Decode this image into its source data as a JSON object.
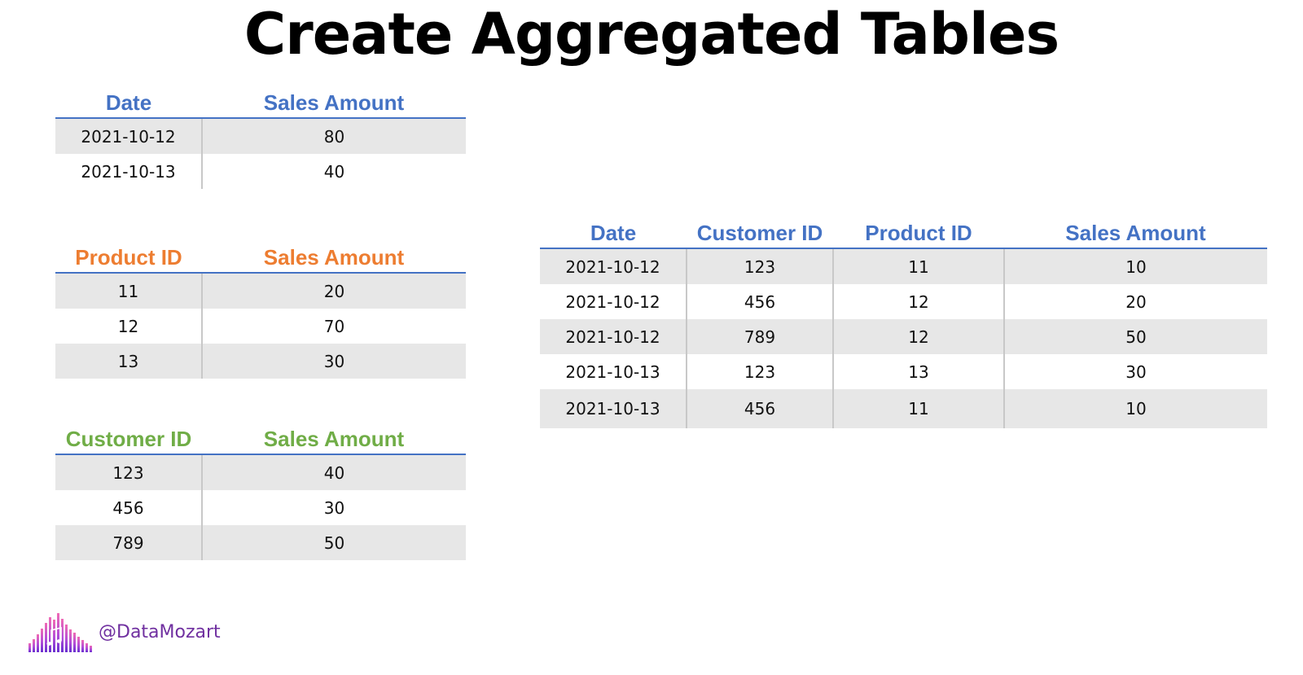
{
  "title": "Create Aggregated Tables",
  "colors": {
    "blue": "#4472c4",
    "orange": "#ed7d31",
    "green": "#70ad47",
    "handle_purple": "#7030a0",
    "row_shade": "#e7e7e7"
  },
  "table_date": {
    "headers": [
      "Date",
      "Sales Amount"
    ],
    "rows": [
      [
        "2021-10-12",
        "80"
      ],
      [
        "2021-10-13",
        "40"
      ]
    ]
  },
  "table_product": {
    "headers": [
      "Product ID",
      "Sales Amount"
    ],
    "rows": [
      [
        "11",
        "20"
      ],
      [
        "12",
        "70"
      ],
      [
        "13",
        "30"
      ]
    ]
  },
  "table_customer": {
    "headers": [
      "Customer ID",
      "Sales Amount"
    ],
    "rows": [
      [
        "123",
        "40"
      ],
      [
        "456",
        "30"
      ],
      [
        "789",
        "50"
      ]
    ]
  },
  "table_detail": {
    "headers": [
      "Date",
      "Customer ID",
      "Product ID",
      "Sales Amount"
    ],
    "rows": [
      [
        "2021-10-12",
        "123",
        "11",
        "10"
      ],
      [
        "2021-10-12",
        "456",
        "12",
        "20"
      ],
      [
        "2021-10-12",
        "789",
        "12",
        "50"
      ],
      [
        "2021-10-13",
        "123",
        "13",
        "30"
      ],
      [
        "2021-10-13",
        "456",
        "11",
        "10"
      ]
    ]
  },
  "footer": {
    "logo_icon": "equalizer-bars-music-note-icon",
    "handle": "@DataMozart"
  }
}
